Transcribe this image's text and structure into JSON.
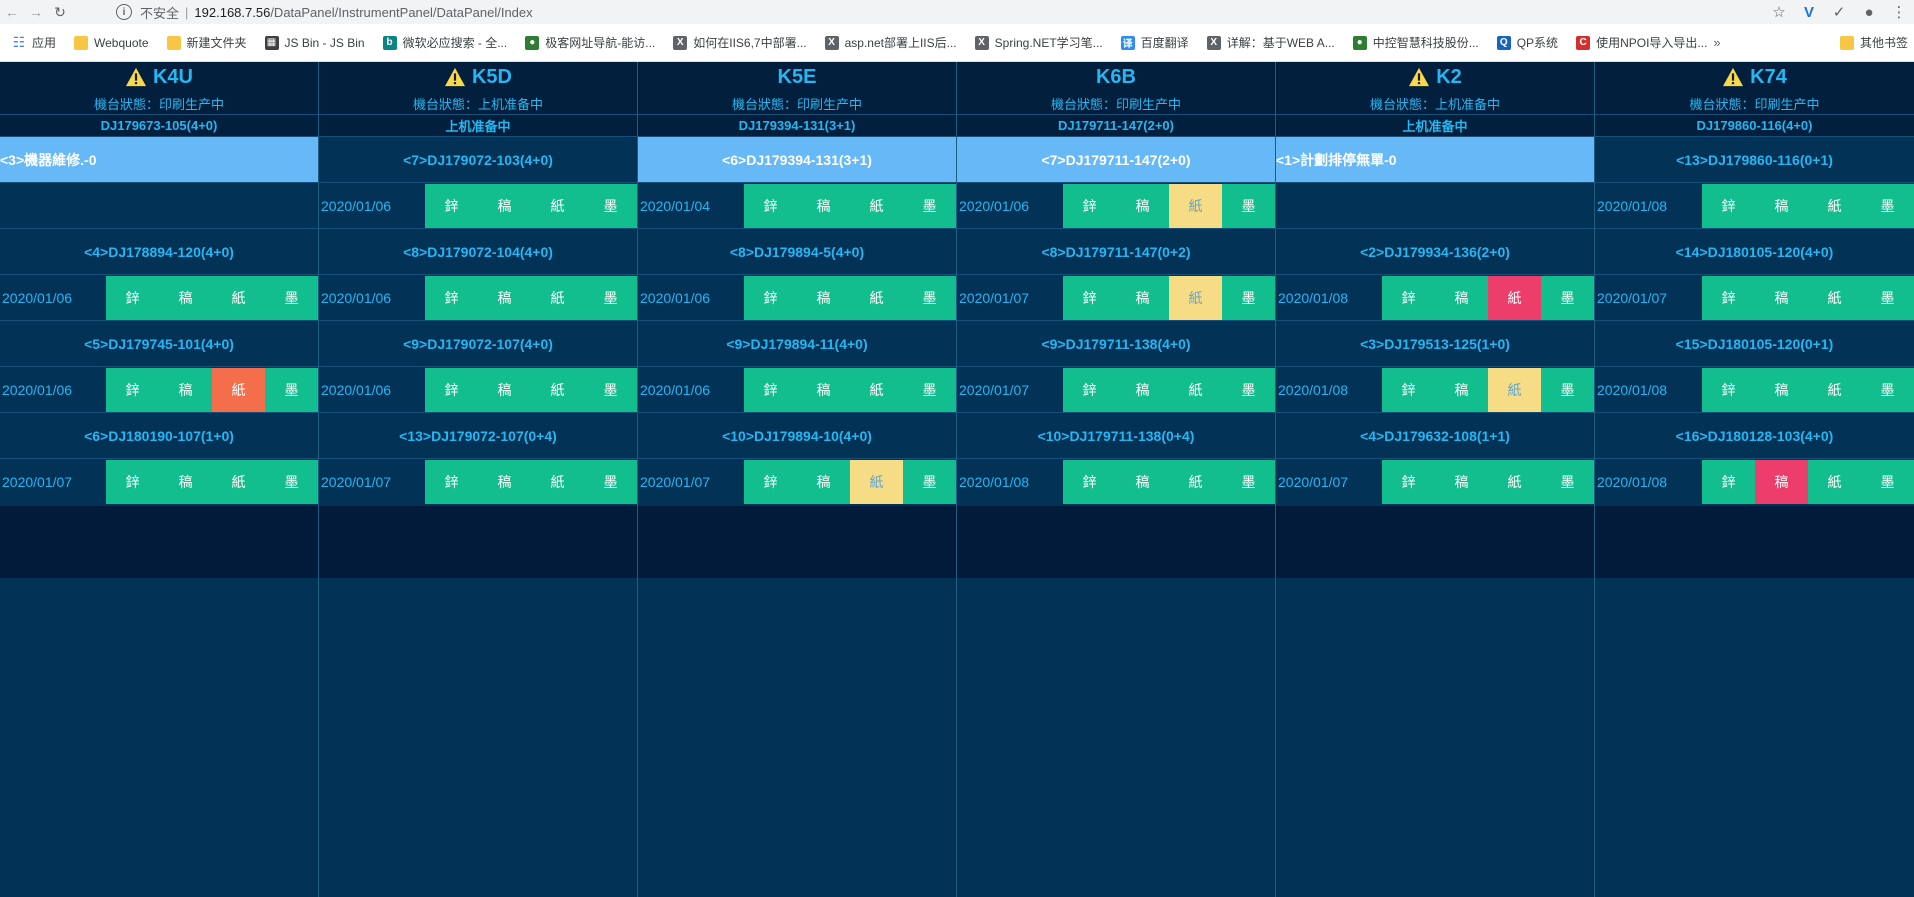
{
  "browser": {
    "security_label": "不安全",
    "url_host": "192.168.7.56",
    "url_path": "/DataPanel/InstrumentPanel/DataPanel/Index",
    "bookmarks": [
      {
        "label": "应用",
        "icon": "apps-icon"
      },
      {
        "label": "Webquote",
        "icon": "folder-icon"
      },
      {
        "label": "新建文件夹",
        "icon": "folder-icon"
      },
      {
        "label": "JS Bin - JS Bin",
        "icon": "jsbin-icon"
      },
      {
        "label": "微软必应搜索 - 全...",
        "icon": "bing-icon"
      },
      {
        "label": "极客网址导航-能访...",
        "icon": "globe-icon"
      },
      {
        "label": "如何在IIS6,7中部署...",
        "icon": "cnblogs-icon"
      },
      {
        "label": "asp.net部署上IIS后...",
        "icon": "cnblogs-icon"
      },
      {
        "label": "Spring.NET学习笔...",
        "icon": "cnblogs-icon"
      },
      {
        "label": "百度翻译",
        "icon": "baidu-translate-icon"
      },
      {
        "label": "详解：基于WEB A...",
        "icon": "cnblogs-icon"
      },
      {
        "label": "中控智慧科技股份...",
        "icon": "globe-icon"
      },
      {
        "label": "QP系统",
        "icon": "qp-icon"
      },
      {
        "label": "使用NPOI导入导出...",
        "icon": "csdn-icon"
      }
    ],
    "more_bookmarks": "其他书签"
  },
  "colors": {
    "board_bg": "#033257",
    "header_bg": "#02203d",
    "text_accent": "#25b7f2",
    "highlight_row": "#66b8f6",
    "cell_green": "#13be8e",
    "cell_yellow": "#f7dc86",
    "cell_red": "#ec3d6b",
    "cell_orange": "#f46e4b"
  },
  "stage_labels": [
    "鋅",
    "稿",
    "紙",
    "墨"
  ],
  "machines": [
    {
      "name": "K4U",
      "warning": true,
      "status": "機台狀態：印刷生产中",
      "current_order": "DJ179673-105(4+0)",
      "jobs": [
        {
          "title": "<3>機器維修.-0",
          "highlight": true,
          "date": "",
          "cells": []
        },
        {
          "title": "<4>DJ178894-120(4+0)",
          "date": "2020/01/06",
          "cells": [
            "green",
            "green",
            "green",
            "green"
          ]
        },
        {
          "title": "<5>DJ179745-101(4+0)",
          "date": "2020/01/06",
          "cells": [
            "green",
            "green",
            "orange",
            "green"
          ]
        },
        {
          "title": "<6>DJ180190-107(1+0)",
          "date": "2020/01/07",
          "cells": [
            "green",
            "green",
            "green",
            "green"
          ]
        }
      ]
    },
    {
      "name": "K5D",
      "warning": true,
      "status": "機台狀態：上机准备中",
      "current_order": "上机准备中",
      "jobs": [
        {
          "title": "<7>DJ179072-103(4+0)",
          "date": "2020/01/06",
          "cells": [
            "green",
            "green",
            "green",
            "green"
          ]
        },
        {
          "title": "<8>DJ179072-104(4+0)",
          "date": "2020/01/06",
          "cells": [
            "green",
            "green",
            "green",
            "green"
          ]
        },
        {
          "title": "<9>DJ179072-107(4+0)",
          "date": "2020/01/06",
          "cells": [
            "green",
            "green",
            "green",
            "green"
          ]
        },
        {
          "title": "<13>DJ179072-107(0+4)",
          "date": "2020/01/07",
          "cells": [
            "green",
            "green",
            "green",
            "green"
          ]
        }
      ]
    },
    {
      "name": "K5E",
      "warning": false,
      "status": "機台狀態：印刷生产中",
      "current_order": "DJ179394-131(3+1)",
      "jobs": [
        {
          "title": "<6>DJ179394-131(3+1)",
          "highlight": true,
          "center": true,
          "date": "2020/01/04",
          "cells": [
            "green",
            "green",
            "green",
            "green"
          ]
        },
        {
          "title": "<8>DJ179894-5(4+0)",
          "date": "2020/01/06",
          "cells": [
            "green",
            "green",
            "green",
            "green"
          ]
        },
        {
          "title": "<9>DJ179894-11(4+0)",
          "date": "2020/01/06",
          "cells": [
            "green",
            "green",
            "green",
            "green"
          ]
        },
        {
          "title": "<10>DJ179894-10(4+0)",
          "date": "2020/01/07",
          "cells": [
            "green",
            "green",
            "yellow",
            "green"
          ]
        }
      ]
    },
    {
      "name": "K6B",
      "warning": false,
      "status": "機台狀態：印刷生产中",
      "current_order": "DJ179711-147(2+0)",
      "jobs": [
        {
          "title": "<7>DJ179711-147(2+0)",
          "highlight": true,
          "center": true,
          "date": "2020/01/06",
          "cells": [
            "green",
            "green",
            "yellow",
            "green"
          ]
        },
        {
          "title": "<8>DJ179711-147(0+2)",
          "date": "2020/01/07",
          "cells": [
            "green",
            "green",
            "yellow",
            "green"
          ]
        },
        {
          "title": "<9>DJ179711-138(4+0)",
          "date": "2020/01/07",
          "cells": [
            "green",
            "green",
            "green",
            "green"
          ]
        },
        {
          "title": "<10>DJ179711-138(0+4)",
          "date": "2020/01/08",
          "cells": [
            "green",
            "green",
            "green",
            "green"
          ]
        }
      ]
    },
    {
      "name": "K2",
      "warning": true,
      "status": "機台狀態：上机准备中",
      "current_order": "上机准备中",
      "jobs": [
        {
          "title": "<1>計劃排停無單-0",
          "highlight": true,
          "date": "",
          "cells": []
        },
        {
          "title": "<2>DJ179934-136(2+0)",
          "date": "2020/01/08",
          "cells": [
            "green",
            "green",
            "red",
            "green"
          ]
        },
        {
          "title": "<3>DJ179513-125(1+0)",
          "date": "2020/01/08",
          "cells": [
            "green",
            "green",
            "yellow",
            "green"
          ]
        },
        {
          "title": "<4>DJ179632-108(1+1)",
          "date": "2020/01/07",
          "cells": [
            "green",
            "green",
            "green",
            "green"
          ]
        }
      ]
    },
    {
      "name": "K74",
      "warning": true,
      "status": "機台狀態：印刷生产中",
      "current_order": "DJ179860-116(4+0)",
      "jobs": [
        {
          "title": "<13>DJ179860-116(0+1)",
          "date": "2020/01/08",
          "cells": [
            "green",
            "green",
            "green",
            "green"
          ]
        },
        {
          "title": "<14>DJ180105-120(4+0)",
          "date": "2020/01/07",
          "cells": [
            "green",
            "green",
            "green",
            "green"
          ]
        },
        {
          "title": "<15>DJ180105-120(0+1)",
          "date": "2020/01/08",
          "cells": [
            "green",
            "green",
            "green",
            "green"
          ]
        },
        {
          "title": "<16>DJ180128-103(4+0)",
          "date": "2020/01/08",
          "cells": [
            "green",
            "red",
            "green",
            "green"
          ]
        }
      ]
    }
  ]
}
